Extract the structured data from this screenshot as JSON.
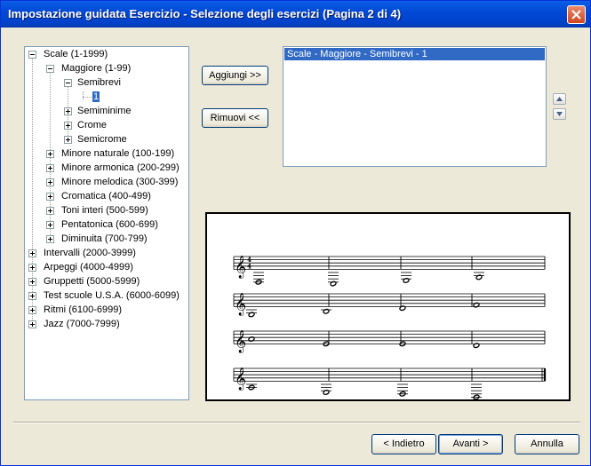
{
  "window": {
    "title": "Impostazione guidata Esercizio - Selezione degli esercizi (Pagina 2 di 4)"
  },
  "tree": {
    "scale": "Scale (1-1999)",
    "maggiore": "Maggiore (1-99)",
    "semibrevi": "Semibrevi",
    "item1": "1",
    "semiminime": "Semiminime",
    "crome": "Crome",
    "semicrome": "Semicrome",
    "minore_naturale": "Minore naturale (100-199)",
    "minore_armonica": "Minore armonica (200-299)",
    "minore_melodica": "Minore melodica (300-399)",
    "cromatica": "Cromatica (400-499)",
    "toni_interi": "Toni interi (500-599)",
    "pentatonica": "Pentatonica (600-699)",
    "diminuita": "Diminuita (700-799)",
    "intervalli": "Intervalli (2000-3999)",
    "arpeggi": "Arpeggi (4000-4999)",
    "gruppetti": "Gruppetti (5000-5999)",
    "test_scuole": "Test scuole U.S.A. (6000-6099)",
    "ritmi": "Ritmi (6100-6999)",
    "jazz": "Jazz (7000-7999)"
  },
  "buttons": {
    "add": "Aggiungi >>",
    "remove": "Rimuovi <<",
    "back": "< Indietro",
    "next": "Avanti >",
    "cancel": "Annulla"
  },
  "selected_list": [
    "Scale  - Maggiore  - Semibrevi - 1"
  ],
  "icons": {
    "close": "close-icon",
    "up": "arrow-up-icon",
    "down": "arrow-down-icon",
    "clef": "treble-clef-icon"
  },
  "colors": {
    "titlebar": "#0249d6",
    "selection": "#316ac5",
    "face": "#ece9d8"
  }
}
